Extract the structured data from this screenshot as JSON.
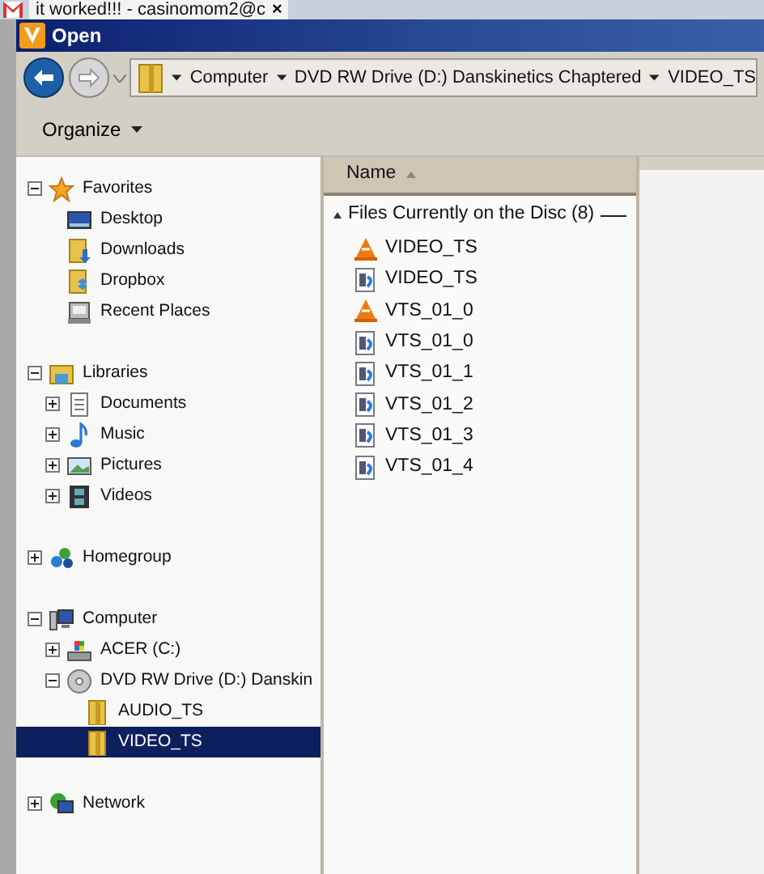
{
  "browser_tab": {
    "title": "it worked!!! - casinomom2@c",
    "close": "×"
  },
  "window": {
    "title": "Open"
  },
  "address_bar": {
    "breadcrumbs": [
      "Computer",
      "DVD RW Drive (D:) Danskinetics Chaptered",
      "VIDEO_TS"
    ]
  },
  "toolbar": {
    "organize": "Organize"
  },
  "nav_tree": [
    {
      "label": "Favorites",
      "kind": "star",
      "expanded": true,
      "selected": false,
      "children": [
        {
          "label": "Desktop",
          "kind": "desktop",
          "selected": false
        },
        {
          "label": "Downloads",
          "kind": "downloads",
          "selected": false
        },
        {
          "label": "Dropbox",
          "kind": "dropbox",
          "selected": false
        },
        {
          "label": "Recent Places",
          "kind": "recent",
          "selected": false
        }
      ]
    },
    {
      "label": "Libraries",
      "kind": "libraries",
      "expanded": true,
      "selected": false,
      "children": [
        {
          "label": "Documents",
          "kind": "documents",
          "expanded": false,
          "selected": false
        },
        {
          "label": "Music",
          "kind": "music",
          "expanded": false,
          "selected": false
        },
        {
          "label": "Pictures",
          "kind": "pictures",
          "expanded": false,
          "selected": false
        },
        {
          "label": "Videos",
          "kind": "videos",
          "expanded": false,
          "selected": false
        }
      ]
    },
    {
      "label": "Homegroup",
      "kind": "homegroup",
      "expanded": false,
      "selected": false
    },
    {
      "label": "Computer",
      "kind": "computer",
      "expanded": true,
      "selected": false,
      "children": [
        {
          "label": "ACER (C:)",
          "kind": "drive",
          "expanded": false,
          "selected": false
        },
        {
          "label": "DVD RW Drive (D:) Danskin",
          "kind": "disc",
          "expanded": true,
          "selected": false,
          "children": [
            {
              "label": "AUDIO_TS",
              "kind": "folder",
              "selected": false
            },
            {
              "label": "VIDEO_TS",
              "kind": "folder",
              "selected": true
            }
          ]
        }
      ]
    },
    {
      "label": "Network",
      "kind": "network",
      "expanded": false,
      "selected": false
    }
  ],
  "file_list": {
    "column": "Name",
    "group": {
      "title": "Files Currently on the Disc (8)",
      "expanded": true
    },
    "files": [
      {
        "name": "VIDEO_TS",
        "kind": "cone"
      },
      {
        "name": "VIDEO_TS",
        "kind": "media"
      },
      {
        "name": "VTS_01_0",
        "kind": "cone"
      },
      {
        "name": "VTS_01_0",
        "kind": "media"
      },
      {
        "name": "VTS_01_1",
        "kind": "media"
      },
      {
        "name": "VTS_01_2",
        "kind": "media"
      },
      {
        "name": "VTS_01_3",
        "kind": "media"
      },
      {
        "name": "VTS_01_4",
        "kind": "media"
      }
    ]
  }
}
